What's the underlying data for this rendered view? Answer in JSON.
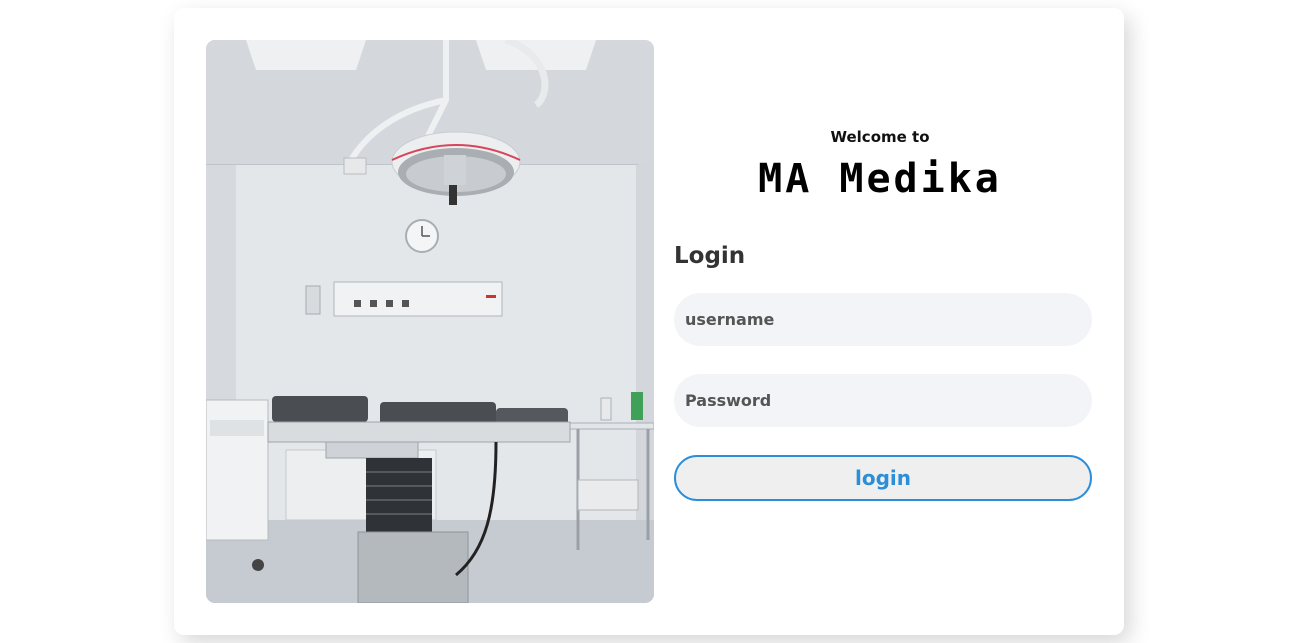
{
  "hero": {
    "image_name": "operating-room-photo"
  },
  "welcome": {
    "subtitle": "Welcome to",
    "brand": "MA Medika"
  },
  "login": {
    "heading": "Login",
    "username_placeholder": "username",
    "username_value": "",
    "password_placeholder": "Password",
    "password_value": "",
    "button_label": "login"
  },
  "colors": {
    "accent": "#2a8fd8",
    "field_bg": "#f3f4f7",
    "button_bg": "#efefef"
  }
}
